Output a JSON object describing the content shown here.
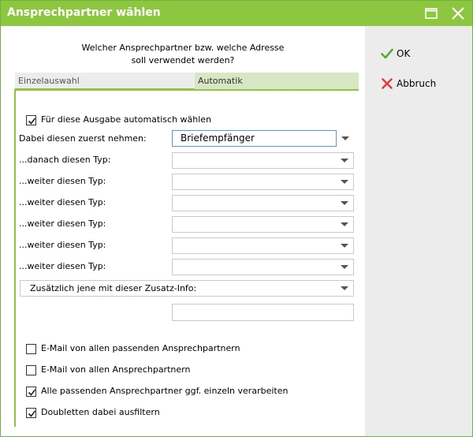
{
  "window": {
    "title": "Ansprechpartner wählen",
    "accent_color": "#8dc63f",
    "maximize_icon": "maximize-icon",
    "close_icon": "close-icon"
  },
  "question": {
    "line1": "Welcher Ansprechpartner bzw. welche Adresse",
    "line2": "soll verwendet werden?"
  },
  "tabs": [
    {
      "label": "Einzelauswahl",
      "active": false
    },
    {
      "label": "Automatik",
      "active": true
    }
  ],
  "auto_select": {
    "label": "Für diese Ausgabe automatisch wählen",
    "checked": true
  },
  "first_type": {
    "label": "Dabei diesen zuerst nehmen:",
    "value": "Briefempfänger"
  },
  "next_types": [
    {
      "label": "...danach diesen Typ:",
      "value": ""
    },
    {
      "label": "...weiter diesen Typ:",
      "value": ""
    },
    {
      "label": "...weiter diesen Typ:",
      "value": ""
    },
    {
      "label": "...weiter diesen Typ:",
      "value": ""
    },
    {
      "label": "...weiter diesen Typ:",
      "value": ""
    },
    {
      "label": "...weiter diesen Typ:",
      "value": ""
    }
  ],
  "additional_info": {
    "label": "Zusätzlich jene mit dieser Zusatz-Info:",
    "value": ""
  },
  "options": [
    {
      "label": "E-Mail von allen passenden Ansprechpartnern",
      "checked": false
    },
    {
      "label": "E-Mail von allen Ansprechpartnern",
      "checked": false
    },
    {
      "label": "Alle passenden Ansprechpartner ggf. einzeln verarbeiten",
      "checked": true
    },
    {
      "label": "Doubletten dabei ausfiltern",
      "checked": true
    }
  ],
  "buttons": {
    "ok": {
      "label": "OK",
      "icon": "check-icon",
      "color": "#5aa832"
    },
    "cancel": {
      "label": "Abbruch",
      "icon": "x-icon",
      "color": "#e23c3c"
    }
  }
}
